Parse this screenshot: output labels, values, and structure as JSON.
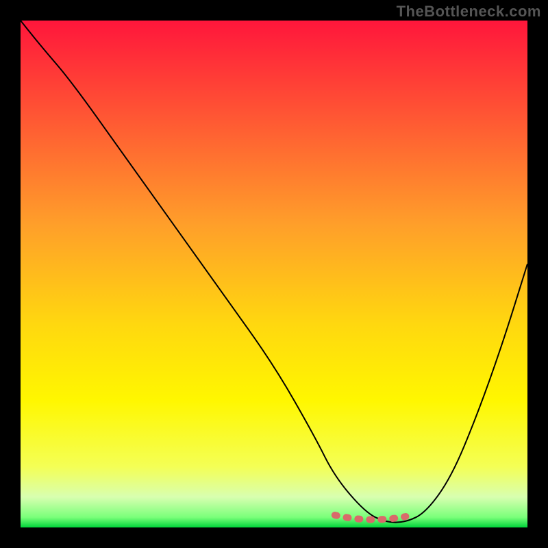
{
  "watermark": "TheBottleneck.com",
  "chart_data": {
    "type": "line",
    "title": "",
    "xlabel": "",
    "ylabel": "",
    "xlim": [
      0,
      100
    ],
    "ylim": [
      0,
      100
    ],
    "grid": false,
    "legend": false,
    "series": [
      {
        "name": "curve",
        "x": [
          0,
          4,
          10,
          20,
          30,
          40,
          50,
          58,
          62,
          68,
          72,
          76,
          80,
          85,
          90,
          95,
          100
        ],
        "values": [
          100,
          95,
          88,
          74,
          60,
          46,
          32,
          18,
          10,
          3,
          1,
          1,
          3,
          10,
          22,
          36,
          52
        ]
      }
    ],
    "highlight": {
      "name": "bottleneck-range",
      "x": [
        62,
        76
      ],
      "values": [
        0,
        0
      ]
    },
    "background_gradient": {
      "stops": [
        {
          "offset": 0.0,
          "color": "#ff163b"
        },
        {
          "offset": 0.2,
          "color": "#ff5a33"
        },
        {
          "offset": 0.4,
          "color": "#ff9e2a"
        },
        {
          "offset": 0.6,
          "color": "#ffd80f"
        },
        {
          "offset": 0.75,
          "color": "#fff700"
        },
        {
          "offset": 0.88,
          "color": "#f4ff55"
        },
        {
          "offset": 0.94,
          "color": "#d8ffb0"
        },
        {
          "offset": 0.98,
          "color": "#7aff7a"
        },
        {
          "offset": 1.0,
          "color": "#00d43a"
        }
      ]
    }
  }
}
